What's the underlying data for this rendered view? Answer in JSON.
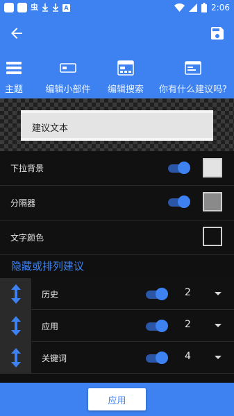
{
  "status_bar": {
    "time": "2:06",
    "notification_glyph": "虫",
    "notification_letter": "A",
    "icons": [
      "square-icon",
      "square-icon",
      "app-icon",
      "download-icon",
      "download-icon",
      "a-icon",
      "wifi-icon",
      "signal-icon",
      "battery-icon"
    ]
  },
  "appbar": {
    "back_icon": "arrow-left-icon",
    "save_icon": "save-icon"
  },
  "tabs": [
    {
      "label": "主题",
      "icon": "theme-icon",
      "active": true
    },
    {
      "label": "编辑小部件",
      "icon": "widget-icon",
      "active": false
    },
    {
      "label": "编辑搜索",
      "icon": "search-edit-icon",
      "active": false
    },
    {
      "label": "你有什么建议吗?",
      "icon": "suggestion-icon",
      "active": false
    }
  ],
  "preview": {
    "search_text": "建议文本"
  },
  "settings": [
    {
      "label": "下拉背景",
      "toggle": true,
      "swatch": "#e3e3e3"
    },
    {
      "label": "分隔器",
      "toggle": true,
      "swatch": "#8a8a8a"
    },
    {
      "label": "文字颜色",
      "toggle": null,
      "swatch": "#111111"
    }
  ],
  "section_title": "隐藏或排列建议",
  "sort_rows": [
    {
      "label": "历史",
      "enabled": true,
      "value": "2"
    },
    {
      "label": "应用",
      "enabled": true,
      "value": "2"
    },
    {
      "label": "关键词",
      "enabled": true,
      "value": "4"
    }
  ],
  "apply_label": "应用",
  "colors": {
    "accent": "#3d82f0",
    "background": "#101010"
  }
}
